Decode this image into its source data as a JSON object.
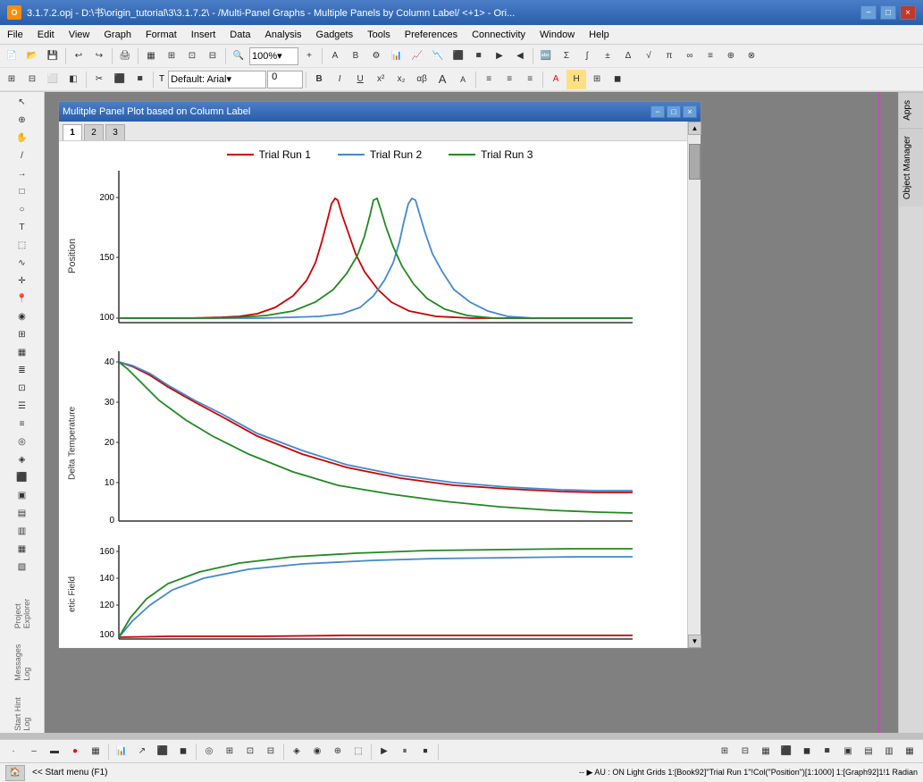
{
  "titlebar": {
    "title": "3.1.7.2.opj - D:\\书\\origin_tutorial\\3\\3.1.7.2\\ - /Multi-Panel Graphs - Multiple Panels by Column Label/ <+1> - Ori...",
    "icon_label": "O",
    "minimize_label": "−",
    "maximize_label": "□",
    "close_label": "×"
  },
  "menubar": {
    "items": [
      "File",
      "Edit",
      "View",
      "Graph",
      "Format",
      "Insert",
      "Data",
      "Analysis",
      "Gadgets",
      "Tools",
      "Preferences",
      "Connectivity",
      "Window",
      "Help"
    ]
  },
  "toolbar": {
    "zoom_value": "100%",
    "font_name": "Default: Arial",
    "font_size": "0"
  },
  "graph_window": {
    "title": "Mulitple Panel Plot based on Column Label",
    "tabs": [
      "1",
      "2",
      "3"
    ],
    "active_tab": "1",
    "minimize": "−",
    "maximize": "□",
    "close": "×"
  },
  "legend": {
    "items": [
      {
        "label": "Trial Run 1",
        "color": "#cc0000"
      },
      {
        "label": "Trial Run 2",
        "color": "#4488cc"
      },
      {
        "label": "Trial Run 3",
        "color": "#228822"
      }
    ]
  },
  "charts": [
    {
      "id": "position_chart",
      "y_label": "Position",
      "y_ticks": [
        "200",
        "150",
        "100"
      ],
      "y_min": 90,
      "y_max": 210
    },
    {
      "id": "delta_temp_chart",
      "y_label": "Delta Temperature",
      "y_ticks": [
        "40",
        "30",
        "20",
        "10",
        "0"
      ],
      "y_min": -2,
      "y_max": 42
    },
    {
      "id": "etic_field_chart",
      "y_label": "etic Field",
      "y_ticks": [
        "160",
        "140",
        "120",
        "100"
      ],
      "y_min": 90,
      "y_max": 170
    }
  ],
  "statusbar": {
    "left_text": "<< Start menu (F1)",
    "right_text": "-- ▶ AU : ON  Light Grids  1:[Book92]\"Trial Run 1\"!Col(\"Position\")[1:1000]  1:[Graph92]1!1  Radian"
  },
  "right_panel": {
    "tabs": [
      "Apps",
      "Object Manager"
    ]
  }
}
